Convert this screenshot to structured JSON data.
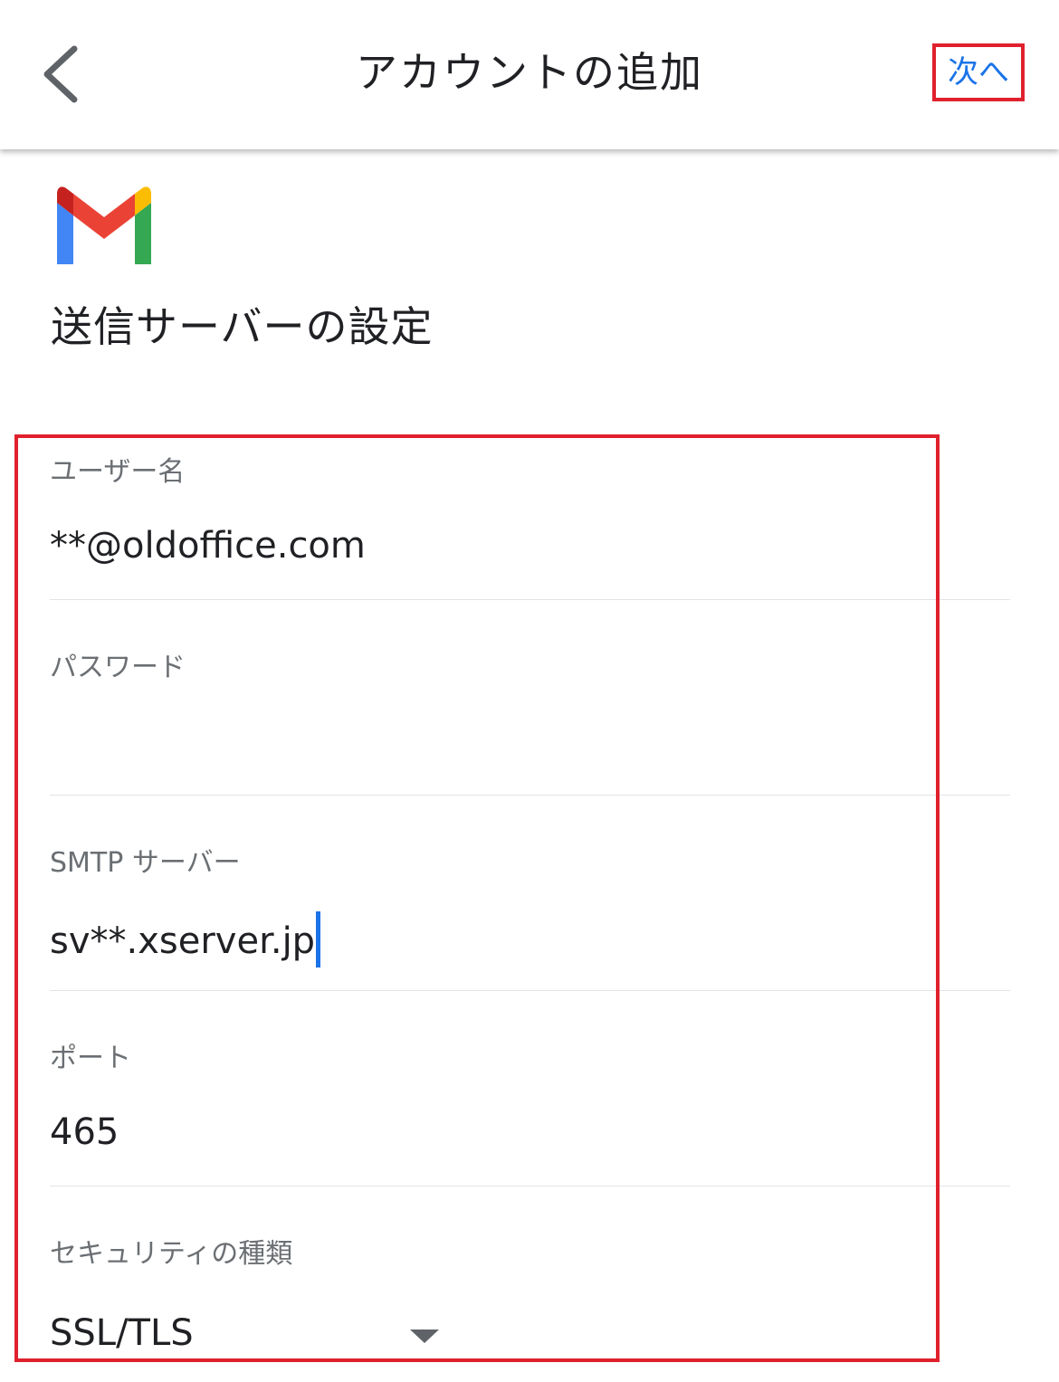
{
  "appbar": {
    "title": "アカウントの追加",
    "back_icon": "chevron-left-icon",
    "next_label": "次へ"
  },
  "logo": {
    "name": "gmail-logo",
    "colors": {
      "red": "#ea4335",
      "dark_red": "#c5221f",
      "blue": "#4285f4",
      "green": "#34a853",
      "yellow": "#fbbc04"
    }
  },
  "page": {
    "heading": "送信サーバーの設定"
  },
  "form": {
    "username": {
      "label": "ユーザー名",
      "value": "**@oldoffice.com"
    },
    "password": {
      "label": "パスワード",
      "value": ""
    },
    "smtp_server": {
      "label": "SMTP サーバー",
      "value": "sv**.xserver.jp"
    },
    "port": {
      "label": "ポート",
      "value": "465"
    },
    "security_type": {
      "label": "セキュリティの種類",
      "selected": "SSL/TLS",
      "dropdown_icon": "caret-down-icon"
    }
  },
  "colors": {
    "accent": "#1a73e8",
    "highlight": "#e0202c",
    "label": "#6b6f73",
    "text": "#202124"
  }
}
